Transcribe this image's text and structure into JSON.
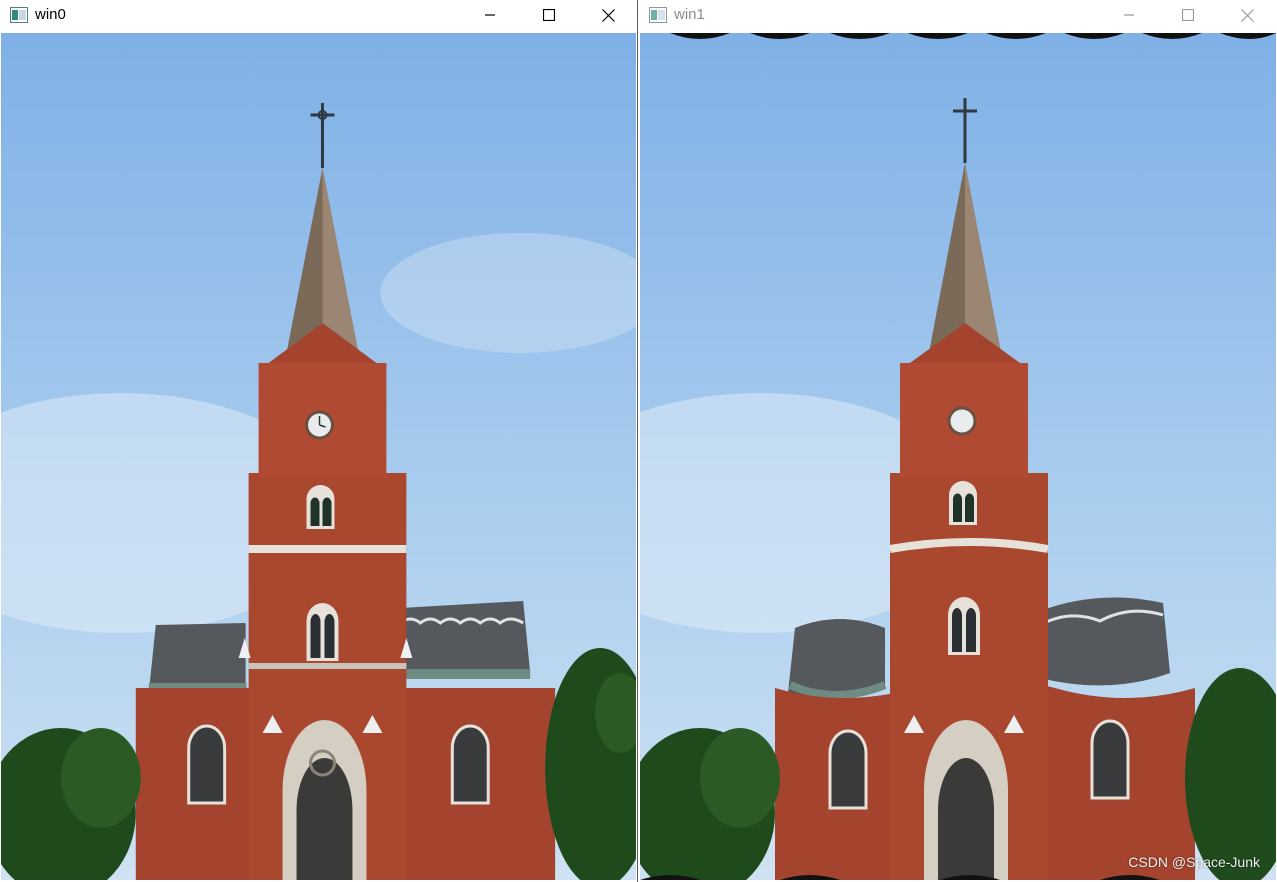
{
  "windows": [
    {
      "title": "win0",
      "active": true
    },
    {
      "title": "win1",
      "active": false
    }
  ],
  "controls": {
    "minimize": "minimize",
    "maximize": "maximize",
    "close": "close"
  },
  "watermark": "CSDN @Space-Junk",
  "colors": {
    "sky_top": "#7fb0e6",
    "sky_bottom": "#cfe2f3",
    "brick": "#a4442f",
    "brick_dark": "#7e3424",
    "roof": "#55585c",
    "spire": "#7c6a59",
    "stone": "#e6e2da",
    "tree": "#1f4a1c"
  }
}
